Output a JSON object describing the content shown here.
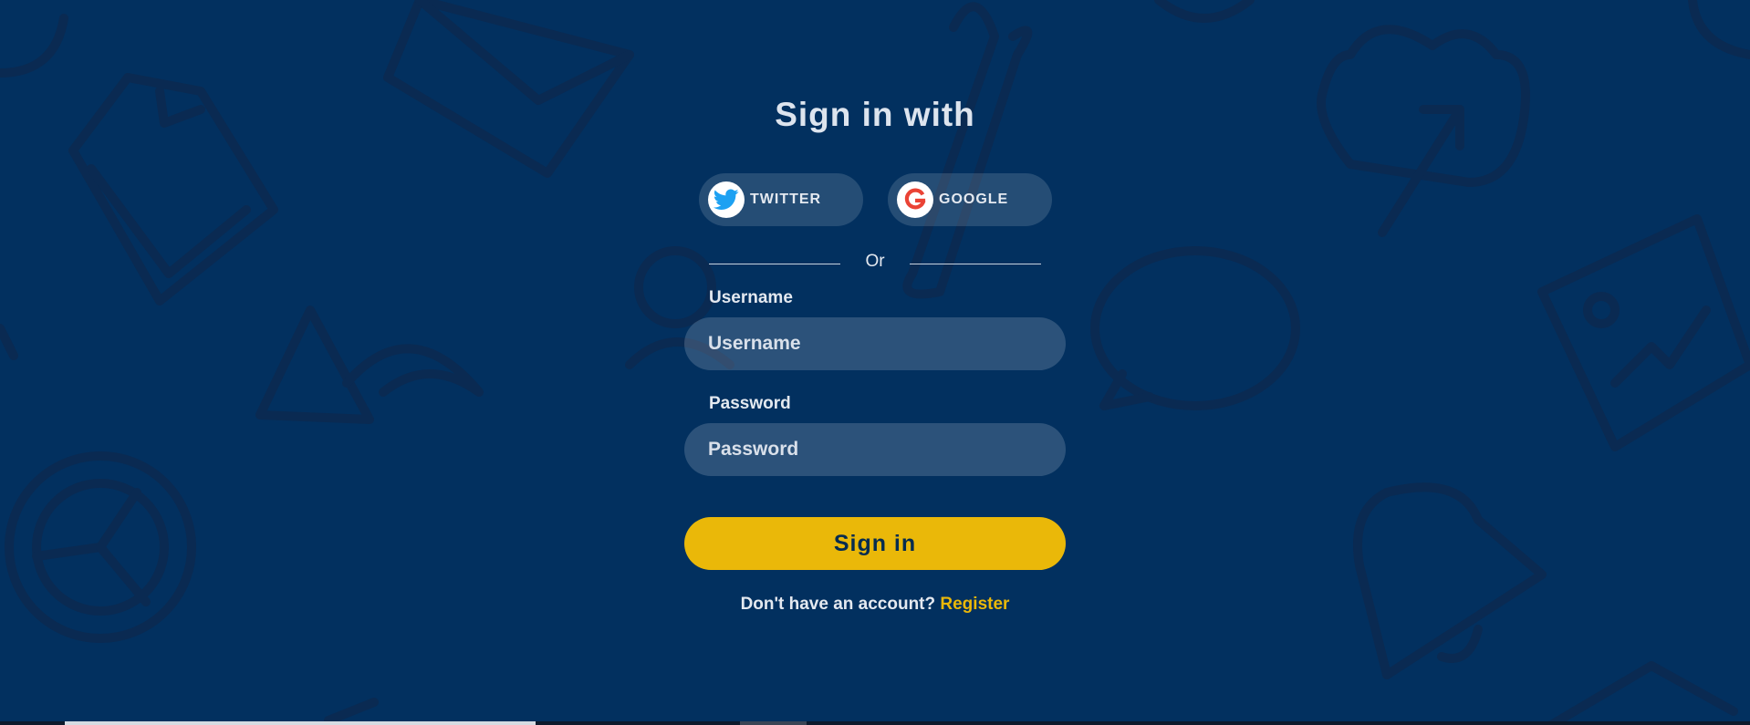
{
  "heading": "Sign in with",
  "social": {
    "twitter_label": "TWITTER",
    "google_label": "GOOGLE"
  },
  "divider_text": "Or",
  "form": {
    "username_label": "Username",
    "username_placeholder": "Username",
    "username_value": "",
    "password_label": "Password",
    "password_placeholder": "Password",
    "password_value": "",
    "submit_label": "Sign in"
  },
  "footer": {
    "prompt": "Don't have an account? ",
    "register_link": "Register"
  },
  "colors": {
    "background": "#02305f",
    "accent": "#eab809",
    "twitter": "#1da1f2",
    "google": "#ea4335"
  },
  "icons": [
    "twitter-icon",
    "google-icon"
  ]
}
